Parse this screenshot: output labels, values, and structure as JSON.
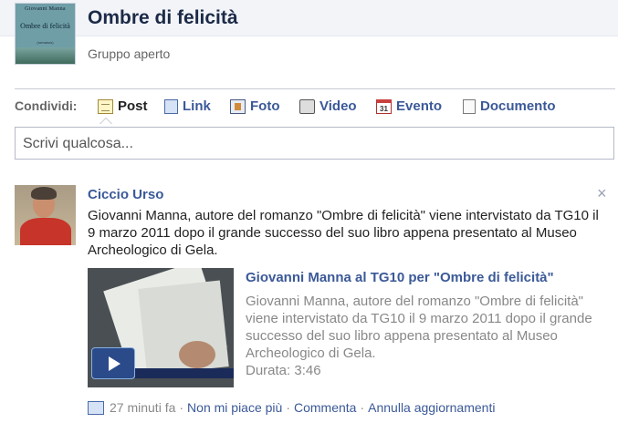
{
  "group": {
    "name": "Ombre di felicità",
    "subtitle": "Gruppo aperto",
    "cover": {
      "author": "Giovanni Manna",
      "title": "Ombre di felicità",
      "subtitle": "(romanzo)"
    }
  },
  "share": {
    "label": "Condividi:",
    "items": [
      {
        "label": "Post",
        "icon": "post-icon"
      },
      {
        "label": "Link",
        "icon": "link-icon"
      },
      {
        "label": "Foto",
        "icon": "photo-icon"
      },
      {
        "label": "Video",
        "icon": "video-camera-icon"
      },
      {
        "label": "Evento",
        "icon": "calendar-icon",
        "calendar_day": "31"
      },
      {
        "label": "Documento",
        "icon": "document-icon"
      }
    ],
    "composer_placeholder": "Scrivi qualcosa..."
  },
  "post": {
    "author": "Ciccio Urso",
    "close": "×",
    "message": "Giovanni Manna, autore del romanzo \"Ombre di felicità\" viene intervistato da TG10 il 9 marzo 2011 dopo il grande successo del suo libro appena presentato al Museo Archeologico di Gela.",
    "attachment": {
      "title": "Giovanni Manna al TG10 per \"Ombre di felicità\"",
      "description": "Giovanni Manna, autore del romanzo \"Ombre di felicità\" viene intervistato da TG10 il 9 marzo 2011 dopo il grande successo del suo libro appena presentato al Museo Archeologico di Gela.",
      "duration": "Durata: 3:46"
    },
    "footer": {
      "time": "27 minuti fa",
      "separator": "·",
      "unlike": "Non mi piace più",
      "comment": "Commenta",
      "unsubscribe": "Annulla aggiornamenti"
    }
  },
  "colors": {
    "link": "#3b5998",
    "title": "#1c2a47",
    "muted": "#888888"
  }
}
